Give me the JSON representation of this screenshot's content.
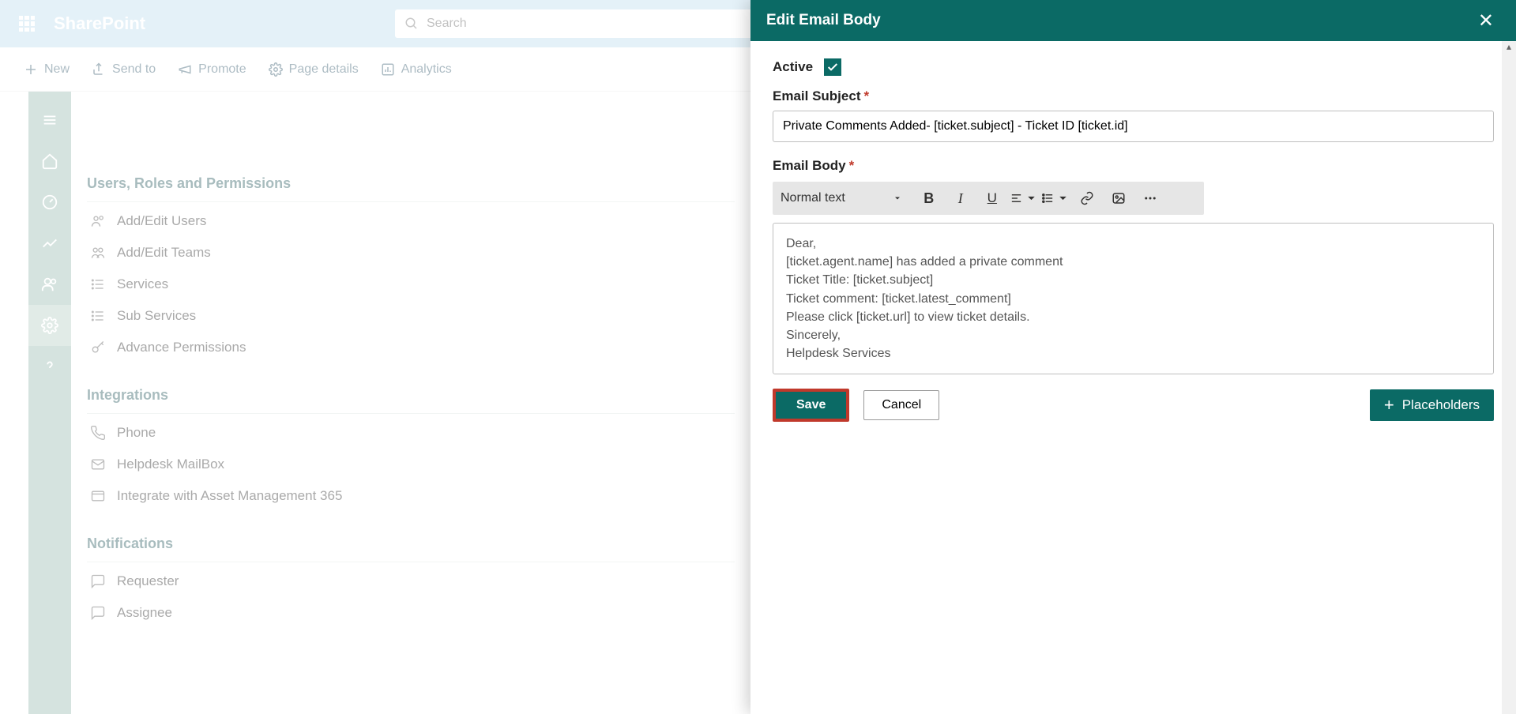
{
  "header": {
    "app_name": "SharePoint",
    "search_placeholder": "Search"
  },
  "cmdbar": {
    "new": "New",
    "send_to": "Send to",
    "promote": "Promote",
    "page_details": "Page details",
    "analytics": "Analytics"
  },
  "content_search_placeholder": "Search",
  "sections": {
    "users": {
      "title": "Users, Roles and Permissions",
      "items": [
        "Add/Edit Users",
        "Add/Edit Teams",
        "Services",
        "Sub Services",
        "Advance Permissions"
      ]
    },
    "integrations": {
      "title": "Integrations",
      "items": [
        "Phone",
        "Helpdesk MailBox",
        "Integrate with Asset Management 365"
      ]
    },
    "notifications": {
      "title": "Notifications",
      "items": [
        "Requester",
        "Assignee"
      ]
    }
  },
  "panel": {
    "title": "Edit Email Body",
    "active_label": "Active",
    "active_checked": true,
    "subject_label": "Email Subject",
    "subject_value": "Private Comments Added- [ticket.subject] - Ticket ID [ticket.id]",
    "body_label": "Email Body",
    "format_label": "Normal text",
    "body_text": "Dear,\n[ticket.agent.name] has added a private comment\nTicket Title: [ticket.subject]\nTicket comment: [ticket.latest_comment]\nPlease click [ticket.url] to view ticket details.\nSincerely,\nHelpdesk Services",
    "save_label": "Save",
    "cancel_label": "Cancel",
    "placeholders_label": "Placeholders"
  },
  "colors": {
    "teal": "#0b6a65",
    "sp_blue": "#c4dfef",
    "highlight_red": "#c0392b"
  }
}
